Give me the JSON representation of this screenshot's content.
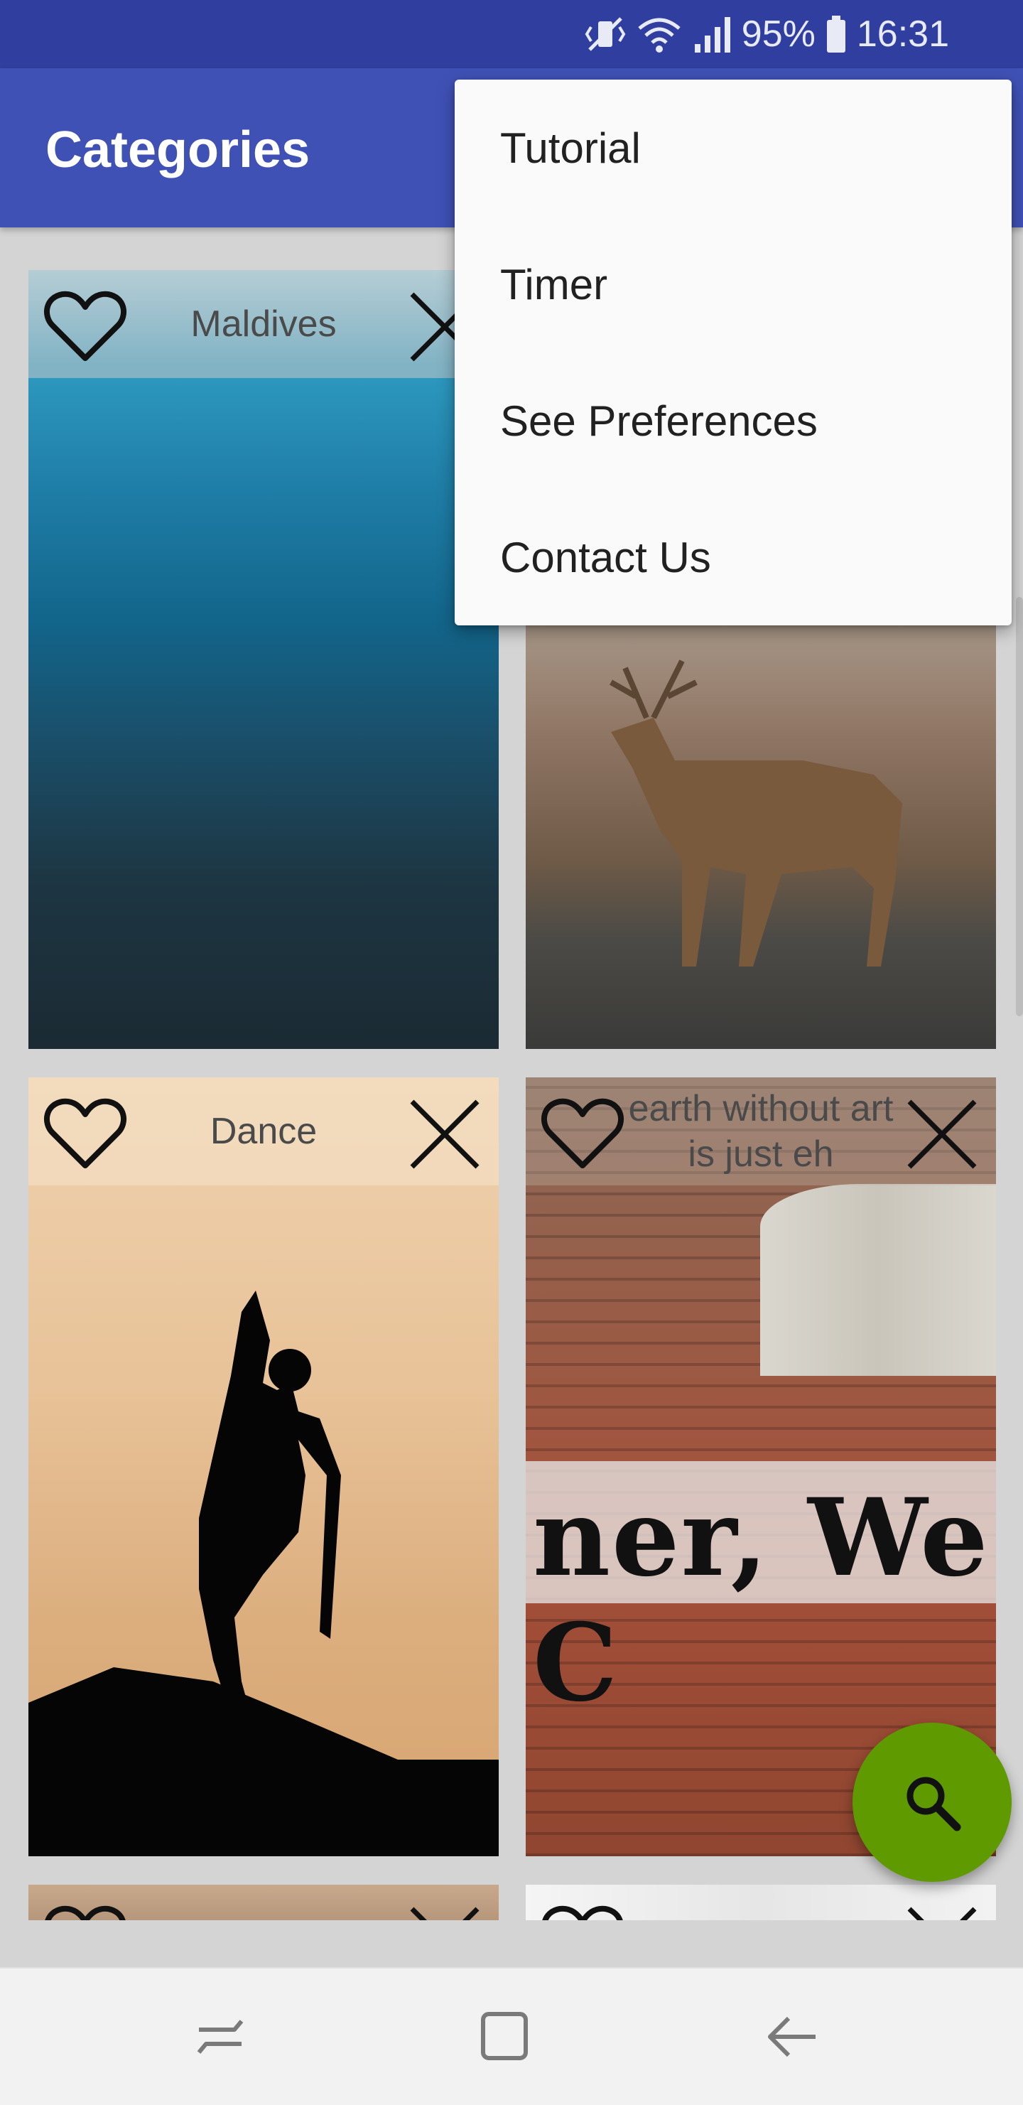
{
  "status_bar": {
    "battery": "95%",
    "time": "16:31",
    "icons": [
      "vibrate-off-icon",
      "wifi-icon",
      "signal-icon",
      "battery-icon"
    ]
  },
  "app_bar": {
    "title": "Categories"
  },
  "menu": {
    "items": [
      {
        "label": "Tutorial"
      },
      {
        "label": "Timer"
      },
      {
        "label": "See Preferences"
      },
      {
        "label": "Contact Us"
      }
    ]
  },
  "cards": [
    {
      "caption": "Maldives",
      "image": "ocean waves photo"
    },
    {
      "caption": "",
      "image": "red deer on road photo"
    },
    {
      "caption": "Dance",
      "image": "dancer silhouette at sunset photo"
    },
    {
      "caption": "earth without art is just eh",
      "image": "brick wall graffiti photo"
    }
  ],
  "fab": {
    "icon": "search-icon",
    "color": "#5f9a00"
  },
  "colors": {
    "primary": "#3f51b5",
    "primary_dark": "#303f9f"
  },
  "nav_bar": {
    "buttons": [
      "recents-icon",
      "home-icon",
      "back-icon"
    ]
  }
}
